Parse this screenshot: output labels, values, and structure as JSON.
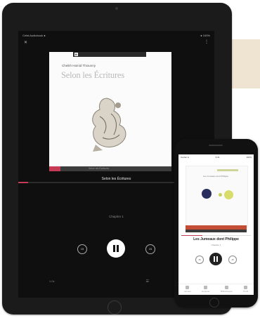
{
  "ipad": {
    "status_left": "Cefal Audiobook ●",
    "status_right": "● 100%",
    "cover": {
      "logo": "B",
      "author": "Cheikh Hamid Thiounny",
      "title": "Selon les Écritures",
      "strip_text": "Selon les Écritures"
    },
    "chapter_label": "Selon les Écritures",
    "subtitle": "Chapitre 1",
    "skip_back_label": "15",
    "skip_fwd_label": "15",
    "bottom_left": "1.0x",
    "bottom_right": "☰",
    "progress_fraction": 0.05
  },
  "iphone": {
    "status_left": "Carrier ●",
    "status_time": "9:41",
    "status_right": "100%",
    "cover_text": "Les Jumeaux dont Philippe",
    "cover_text2": "",
    "title": "Les Jumeaux dont Philippe",
    "subtitle": "Chapitre 1",
    "skip_back_label": "15",
    "skip_fwd_label": "15",
    "progress_fraction": 0.3,
    "tabs": [
      "Accueil",
      "Explorer",
      "Bibliothèque",
      "Profil"
    ]
  },
  "colors": {
    "accent": "#c43b56",
    "beige": "#efe3d2"
  }
}
